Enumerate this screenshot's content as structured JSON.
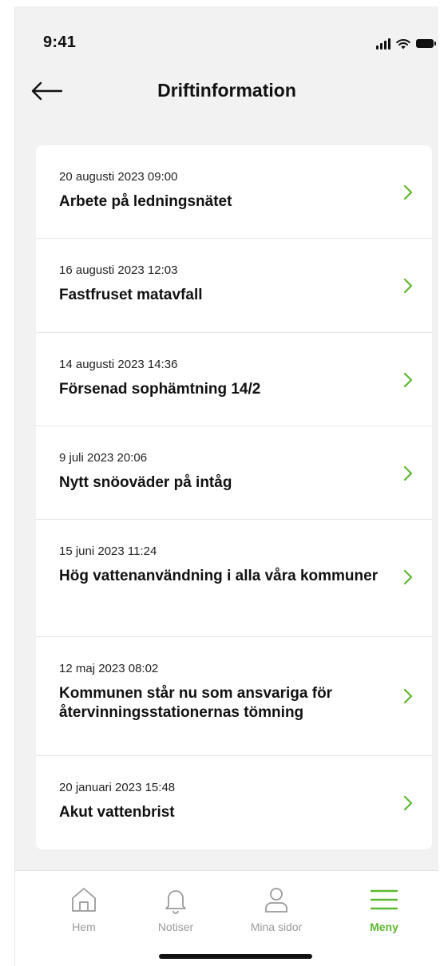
{
  "status_bar": {
    "time": "9:41"
  },
  "header": {
    "title": "Driftinformation"
  },
  "items": [
    {
      "date": "20 augusti 2023 09:00",
      "title": "Arbete på ledningsnätet"
    },
    {
      "date": "16 augusti 2023 12:03",
      "title": "Fastfruset matavfall"
    },
    {
      "date": "14 augusti 2023 14:36",
      "title": "Försenad sophämtning 14/2"
    },
    {
      "date": "9 juli 2023 20:06",
      "title": "Nytt snöoväder på intåg"
    },
    {
      "date": "15 juni 2023 11:24",
      "title": "Hög vattenanvändning i alla våra kommuner"
    },
    {
      "date": "12 maj 2023 08:02",
      "title": "Kommunen står nu som ansvariga för återvinningsstationernas tömning"
    },
    {
      "date": "20 januari 2023 15:48",
      "title": "Akut vattenbrist"
    }
  ],
  "nav": {
    "home": "Hem",
    "notifications": "Notiser",
    "my_pages": "Mina sidor",
    "menu": "Meny"
  },
  "colors": {
    "accent": "#5cb82e",
    "background": "#f2f2f2"
  }
}
